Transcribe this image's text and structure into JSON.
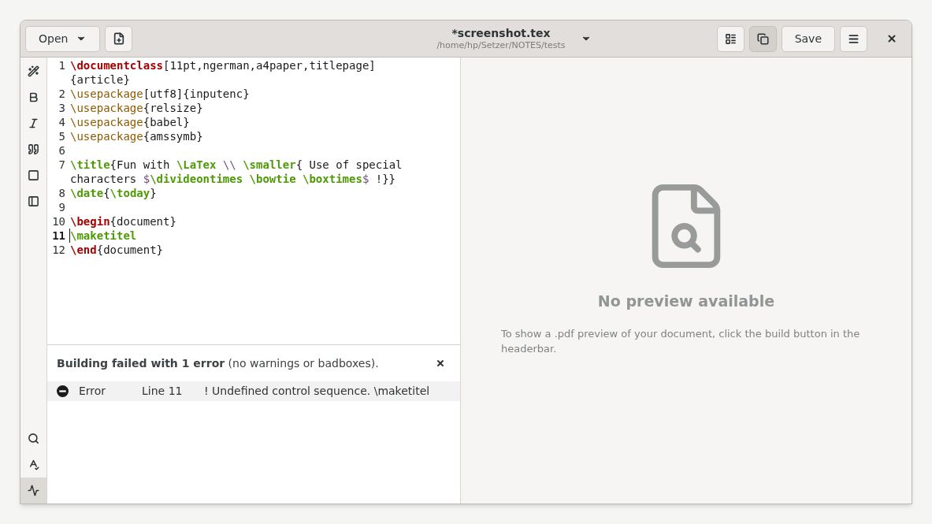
{
  "headerbar": {
    "open_button": "Open",
    "title": "*screenshot.tex",
    "subtitle": "/home/hp/Setzer/NOTES/tests",
    "toggles": [
      {
        "kind": "structure",
        "selected": false
      },
      {
        "kind": "preview",
        "selected": true
      }
    ],
    "save_button": "Save"
  },
  "sidebar": {
    "top": [
      {
        "kind": "wand"
      },
      {
        "kind": "bold"
      },
      {
        "kind": "italic"
      },
      {
        "kind": "quote"
      },
      {
        "kind": "square"
      },
      {
        "kind": "panel"
      }
    ],
    "bottom": [
      {
        "kind": "search",
        "selected": false
      },
      {
        "kind": "spell",
        "selected": false
      },
      {
        "kind": "log",
        "selected": true
      }
    ]
  },
  "editor": {
    "lines": [
      {
        "number": "1",
        "current": false,
        "rows": [
          {
            "tokens": [
              {
                "kind": "keyword",
                "text": "\\documentclass"
              },
              {
                "kind": "text",
                "text": "[11pt,ngerman,a4paper,titlepage]"
              }
            ]
          },
          {
            "tokens": [
              {
                "kind": "text",
                "text": "{article}"
              }
            ]
          }
        ]
      },
      {
        "number": "2",
        "current": false,
        "rows": [
          {
            "tokens": [
              {
                "kind": "package",
                "text": "\\usepackage"
              },
              {
                "kind": "text",
                "text": "[utf8]{inputenc}"
              }
            ]
          }
        ]
      },
      {
        "number": "3",
        "current": false,
        "rows": [
          {
            "tokens": [
              {
                "kind": "package",
                "text": "\\usepackage"
              },
              {
                "kind": "text",
                "text": "{relsize}"
              }
            ]
          }
        ]
      },
      {
        "number": "4",
        "current": false,
        "rows": [
          {
            "tokens": [
              {
                "kind": "package",
                "text": "\\usepackage"
              },
              {
                "kind": "text",
                "text": "{babel}"
              }
            ]
          }
        ]
      },
      {
        "number": "5",
        "current": false,
        "rows": [
          {
            "tokens": [
              {
                "kind": "package",
                "text": "\\usepackage"
              },
              {
                "kind": "text",
                "text": "{amssymb}"
              }
            ]
          }
        ]
      },
      {
        "number": "6",
        "current": false
      },
      {
        "number": "7",
        "current": false,
        "rows": [
          {
            "tokens": [
              {
                "kind": "command",
                "text": "\\title"
              },
              {
                "kind": "text",
                "text": "{Fun with "
              },
              {
                "kind": "command",
                "text": "\\LaTex "
              },
              {
                "kind": "math",
                "text": "\\\\ "
              },
              {
                "kind": "command",
                "text": "\\smaller"
              },
              {
                "kind": "text",
                "text": "{ Use of special"
              }
            ]
          },
          {
            "tokens": [
              {
                "kind": "text",
                "text": "characters "
              },
              {
                "kind": "math",
                "text": "$"
              },
              {
                "kind": "command",
                "text": "\\divideontimes \\bowtie \\boxtimes"
              },
              {
                "kind": "math",
                "text": "$"
              },
              {
                "kind": "text",
                "text": " !}}"
              }
            ]
          }
        ]
      },
      {
        "number": "8",
        "current": false,
        "rows": [
          {
            "tokens": [
              {
                "kind": "command",
                "text": "\\date"
              },
              {
                "kind": "text",
                "text": "{"
              },
              {
                "kind": "command",
                "text": "\\today"
              },
              {
                "kind": "text",
                "text": "}"
              }
            ]
          }
        ]
      },
      {
        "number": "9",
        "current": false
      },
      {
        "number": "10",
        "current": false,
        "rows": [
          {
            "tokens": [
              {
                "kind": "keyword",
                "text": "\\begin"
              },
              {
                "kind": "text",
                "text": "{document}"
              }
            ]
          }
        ]
      },
      {
        "number": "11",
        "current": true,
        "rows": [
          {
            "tokens": [
              {
                "kind": "command",
                "text": "\\maketitel"
              }
            ]
          }
        ]
      },
      {
        "number": "12",
        "current": false,
        "rows": [
          {
            "tokens": [
              {
                "kind": "keyword",
                "text": "\\end"
              },
              {
                "kind": "text",
                "text": "{document}"
              }
            ]
          }
        ]
      }
    ]
  },
  "build_log": {
    "summary": "**Building failed with 1 error** (no warnings or badboxes).",
    "rows": [
      {
        "type": "Error",
        "line": "Line 11",
        "message": "! Undefined control sequence. \\maketitel"
      }
    ]
  },
  "preview": {
    "heading": "No preview available",
    "text": "To show a .pdf preview of your document, click the build button in the headerbar."
  }
}
